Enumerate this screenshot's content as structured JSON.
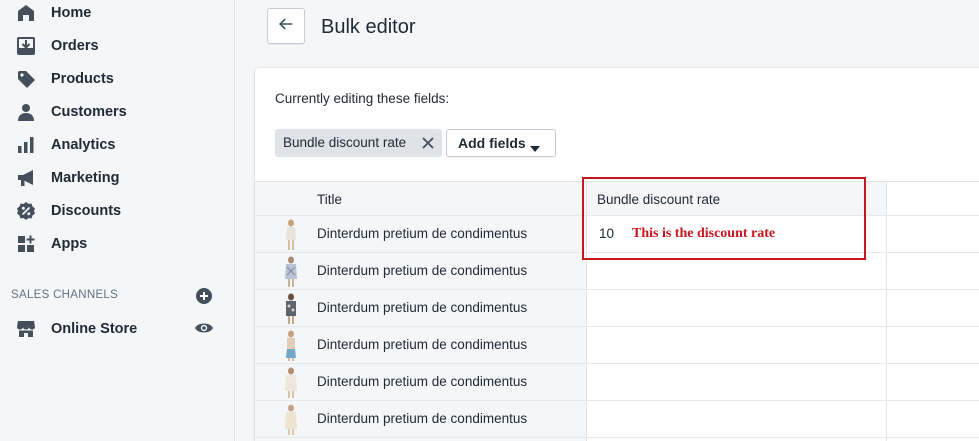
{
  "sidebar": {
    "items": [
      {
        "label": "Home",
        "icon": "home-icon"
      },
      {
        "label": "Orders",
        "icon": "orders-icon"
      },
      {
        "label": "Products",
        "icon": "tag-icon"
      },
      {
        "label": "Customers",
        "icon": "person-icon"
      },
      {
        "label": "Analytics",
        "icon": "bar-chart-icon"
      },
      {
        "label": "Marketing",
        "icon": "megaphone-icon"
      },
      {
        "label": "Discounts",
        "icon": "discount-icon"
      },
      {
        "label": "Apps",
        "icon": "apps-icon"
      }
    ],
    "sales_channels_label": "SALES CHANNELS",
    "online_store_label": "Online Store"
  },
  "header": {
    "title": "Bulk editor"
  },
  "editor": {
    "editing_label": "Currently editing these fields:",
    "field_tag": "Bundle discount rate",
    "add_fields_label": "Add fields"
  },
  "table": {
    "columns": [
      "Title",
      "Bundle discount rate"
    ],
    "rows": [
      {
        "title": "Dinterdum pretium de condimentus",
        "rate": "10"
      },
      {
        "title": "Dinterdum pretium de condimentus",
        "rate": ""
      },
      {
        "title": "Dinterdum pretium de condimentus",
        "rate": ""
      },
      {
        "title": "Dinterdum pretium de condimentus",
        "rate": ""
      },
      {
        "title": "Dinterdum pretium de condimentus",
        "rate": ""
      },
      {
        "title": "Dinterdum pretium de condimentus",
        "rate": ""
      }
    ]
  },
  "annotation": {
    "text": "This is the discount rate",
    "color": "#c8161d"
  },
  "colors": {
    "sidebar_bg": "#f4f6f8",
    "text": "#212b36",
    "muted": "#637381",
    "border": "#dfe3e8"
  }
}
